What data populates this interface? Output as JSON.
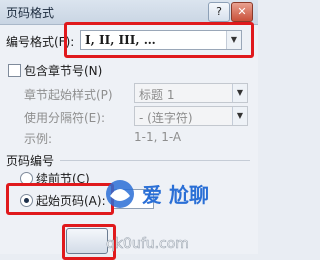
{
  "dialog": {
    "title": "页码格式",
    "help_label": "?",
    "close_label": "✕"
  },
  "number_format": {
    "label": "编号格式(F):",
    "value": "I, II, III, …"
  },
  "include_chapter": {
    "label": "包含章节号(N)",
    "checked": false
  },
  "chapter_style": {
    "label": "章节起始样式(P)",
    "value": "标题 1"
  },
  "separator": {
    "label": "使用分隔符(E):",
    "value": "- (连字符)"
  },
  "example": {
    "label": "示例:",
    "value": "1-1, 1-A"
  },
  "page_numbering": {
    "section_label": "页码编号",
    "continue_label": "续前节(C)",
    "start_at_label": "起始页码(A):",
    "selected": "start_at"
  },
  "watermark": {
    "text_top": "爱 尬聊",
    "text_url": "qk0ufu.com"
  },
  "colors": {
    "highlight": "#e0191c",
    "accent": "#2a6fd6"
  }
}
